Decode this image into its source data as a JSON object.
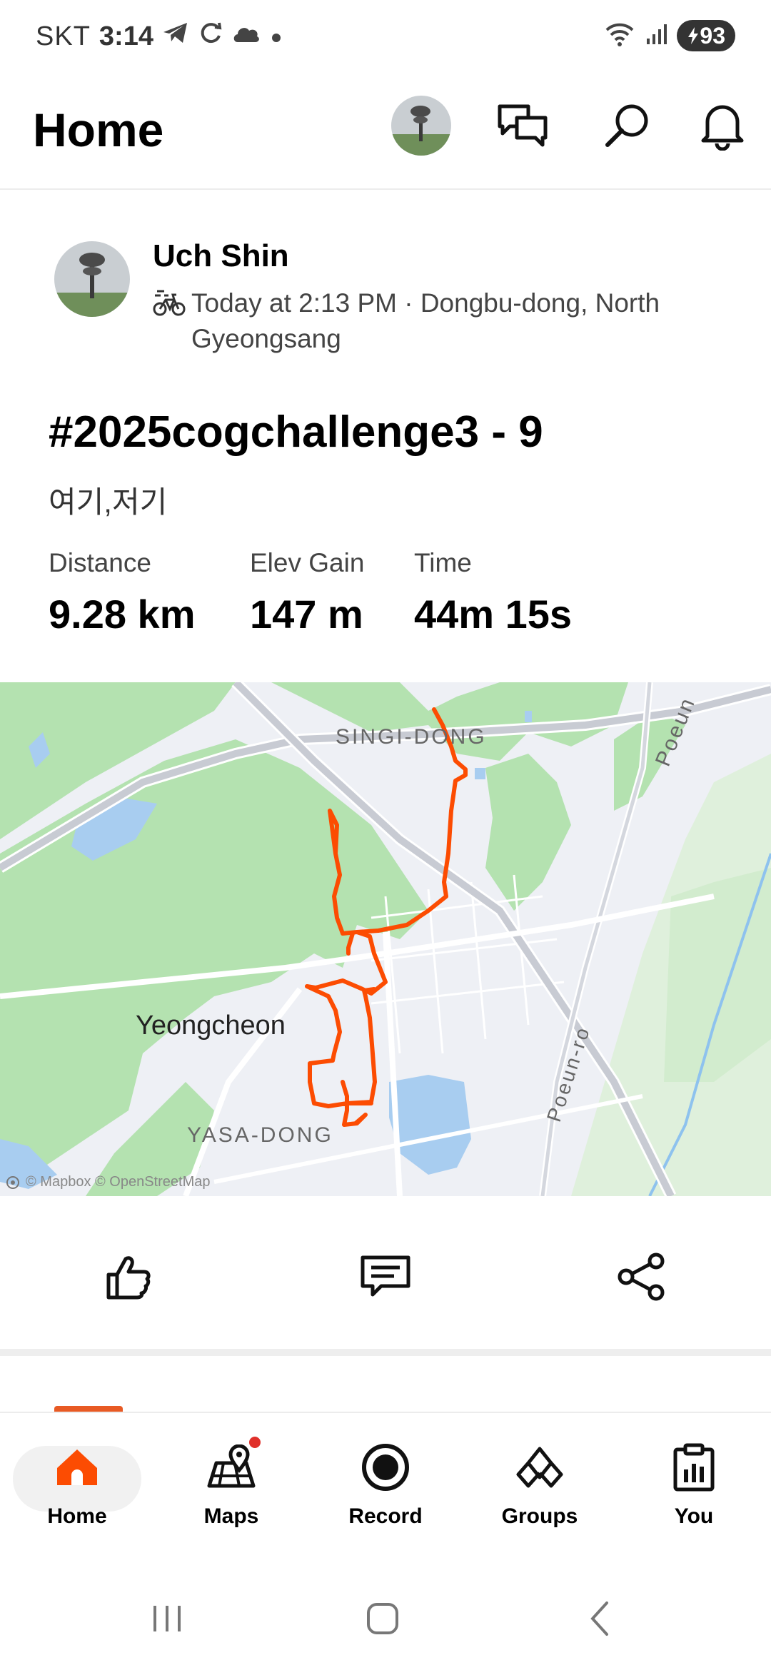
{
  "status_bar": {
    "carrier": "SKT",
    "time": "3:14",
    "battery": "93"
  },
  "header": {
    "title": "Home"
  },
  "post": {
    "author": "Uch Shin",
    "meta": "Today at 2:13 PM · Dongbu-dong, North Gyeongsang",
    "activity_type_icon": "bike-icon",
    "title": "#2025cogchallenge3 -  9",
    "description": "여기,저기",
    "stats": [
      {
        "label": "Distance",
        "value": "9.28 km"
      },
      {
        "label": "Elev Gain",
        "value": "147 m"
      },
      {
        "label": "Time",
        "value": "44m 15s"
      }
    ]
  },
  "map": {
    "labels": {
      "singi": "SINGI-DONG",
      "poeun_top": "Poeun",
      "yeongcheon": "Yeongcheon",
      "poeun_ro": "Poeun-ro",
      "yasa": "YASA-DONG"
    },
    "attribution": "© Mapbox © OpenStreetMap",
    "route_color": "#fc4c02",
    "park_color": "#b4e2b0",
    "water_color": "#a8cdf0"
  },
  "actions": {
    "like": "thumbs-up-icon",
    "comment": "comment-icon",
    "share": "share-icon"
  },
  "bottom_nav": {
    "items": [
      {
        "label": "Home",
        "icon": "home-icon",
        "active": true
      },
      {
        "label": "Maps",
        "icon": "map-icon",
        "badge": true
      },
      {
        "label": "Record",
        "icon": "record-icon"
      },
      {
        "label": "Groups",
        "icon": "groups-icon"
      },
      {
        "label": "You",
        "icon": "clipboard-chart-icon"
      }
    ]
  },
  "colors": {
    "accent": "#fc4c02",
    "text": "#000000",
    "secondary_text": "#444444"
  }
}
